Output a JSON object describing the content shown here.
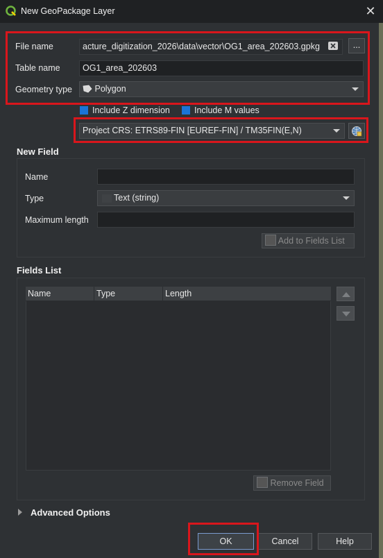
{
  "window": {
    "title": "New GeoPackage Layer",
    "close_glyph": "✕"
  },
  "file_name": {
    "label": "File name",
    "value": "acture_digitization_2026\\data\\vector\\OG1_area_202603.gpkg",
    "browse_label": "..."
  },
  "table_name": {
    "label": "Table name",
    "value": "OG1_area_202603"
  },
  "geometry_type": {
    "label": "Geometry type",
    "value": "Polygon"
  },
  "include_z": {
    "label": "Include Z dimension"
  },
  "include_m": {
    "label": "Include M values"
  },
  "crs": {
    "value": "Project CRS: ETRS89-FIN [EUREF-FIN] / TM35FIN(E,N)"
  },
  "new_field": {
    "title": "New Field",
    "name_label": "Name",
    "name_value": "",
    "type_label": "Type",
    "type_value": "Text (string)",
    "max_length_label": "Maximum length",
    "max_length_value": "",
    "add_button": "Add to Fields List"
  },
  "fields_list": {
    "title": "Fields List",
    "columns": [
      "Name",
      "Type",
      "Length"
    ],
    "remove_button": "Remove Field"
  },
  "advanced": {
    "label": "Advanced Options"
  },
  "buttons": {
    "ok": "OK",
    "cancel": "Cancel",
    "help": "Help"
  },
  "colors": {
    "highlight": "#d9161c",
    "checkbox": "#1a74d8",
    "qgis_green": "#6fb43f"
  }
}
